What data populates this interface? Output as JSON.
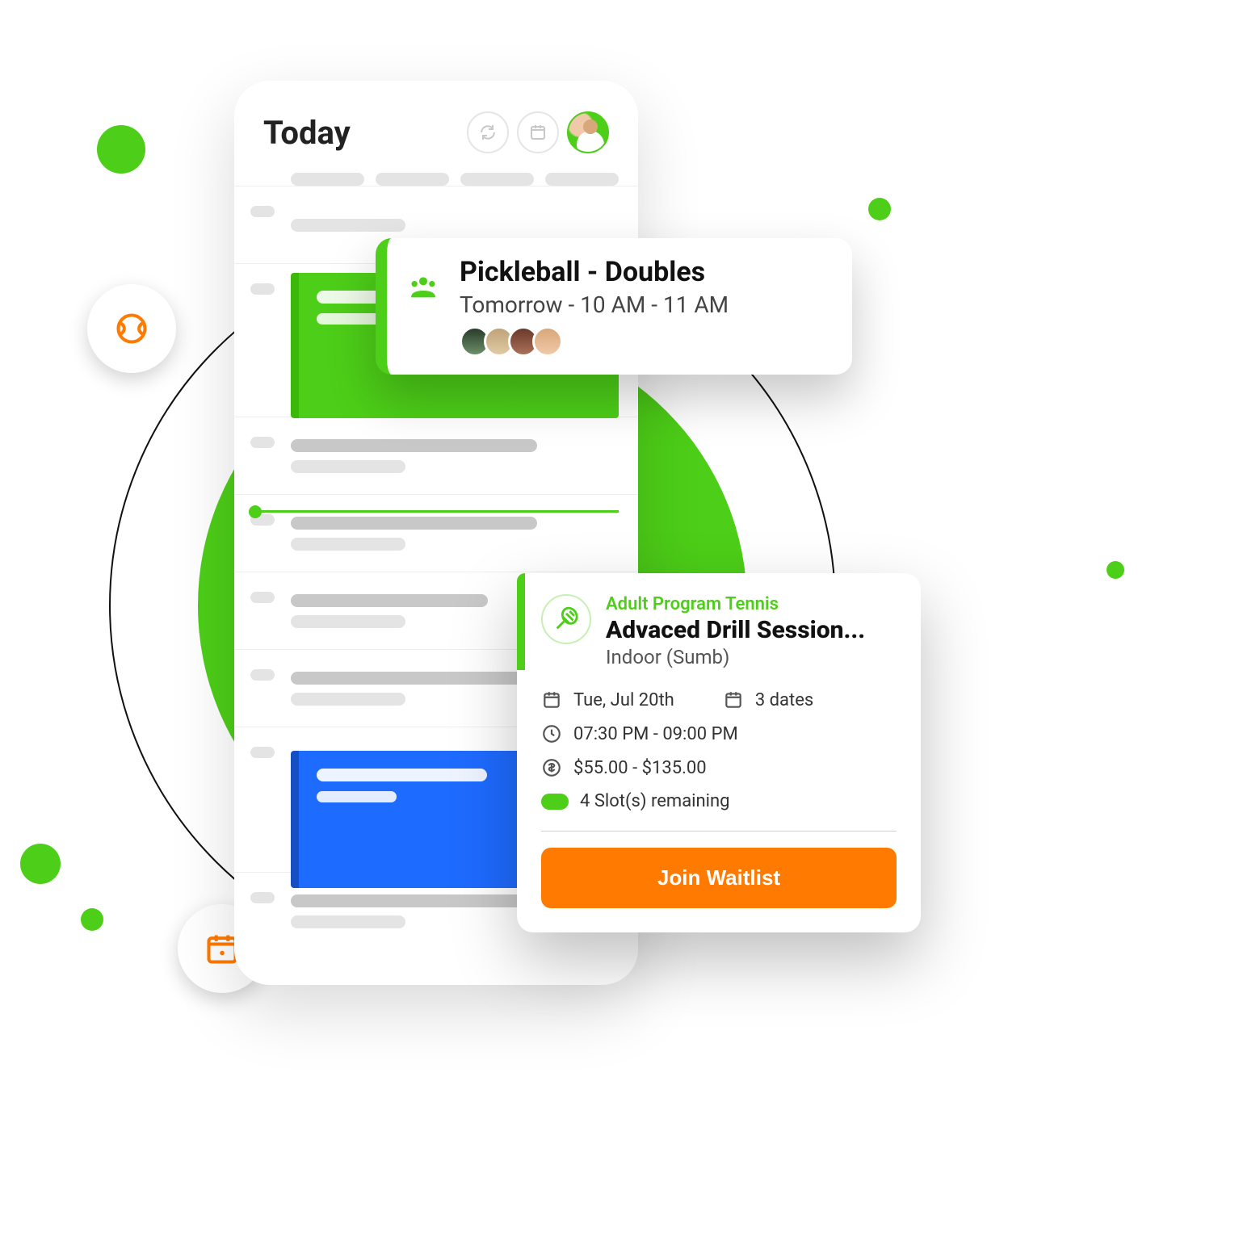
{
  "header": {
    "title": "Today"
  },
  "popover": {
    "title": "Pickleball - Doubles",
    "subtitle": "Tomorrow - 10 AM - 11 AM"
  },
  "event": {
    "category": "Adult Program Tennis",
    "title": "Advaced Drill Session...",
    "location": "Indoor (Sumb)",
    "date": "Tue, Jul 20th",
    "dates_count": "3 dates",
    "time": "07:30 PM - 09:00 PM",
    "price": "$55.00 - $135.00",
    "slots": "4 Slot(s) remaining",
    "cta": "Join Waitlist"
  }
}
